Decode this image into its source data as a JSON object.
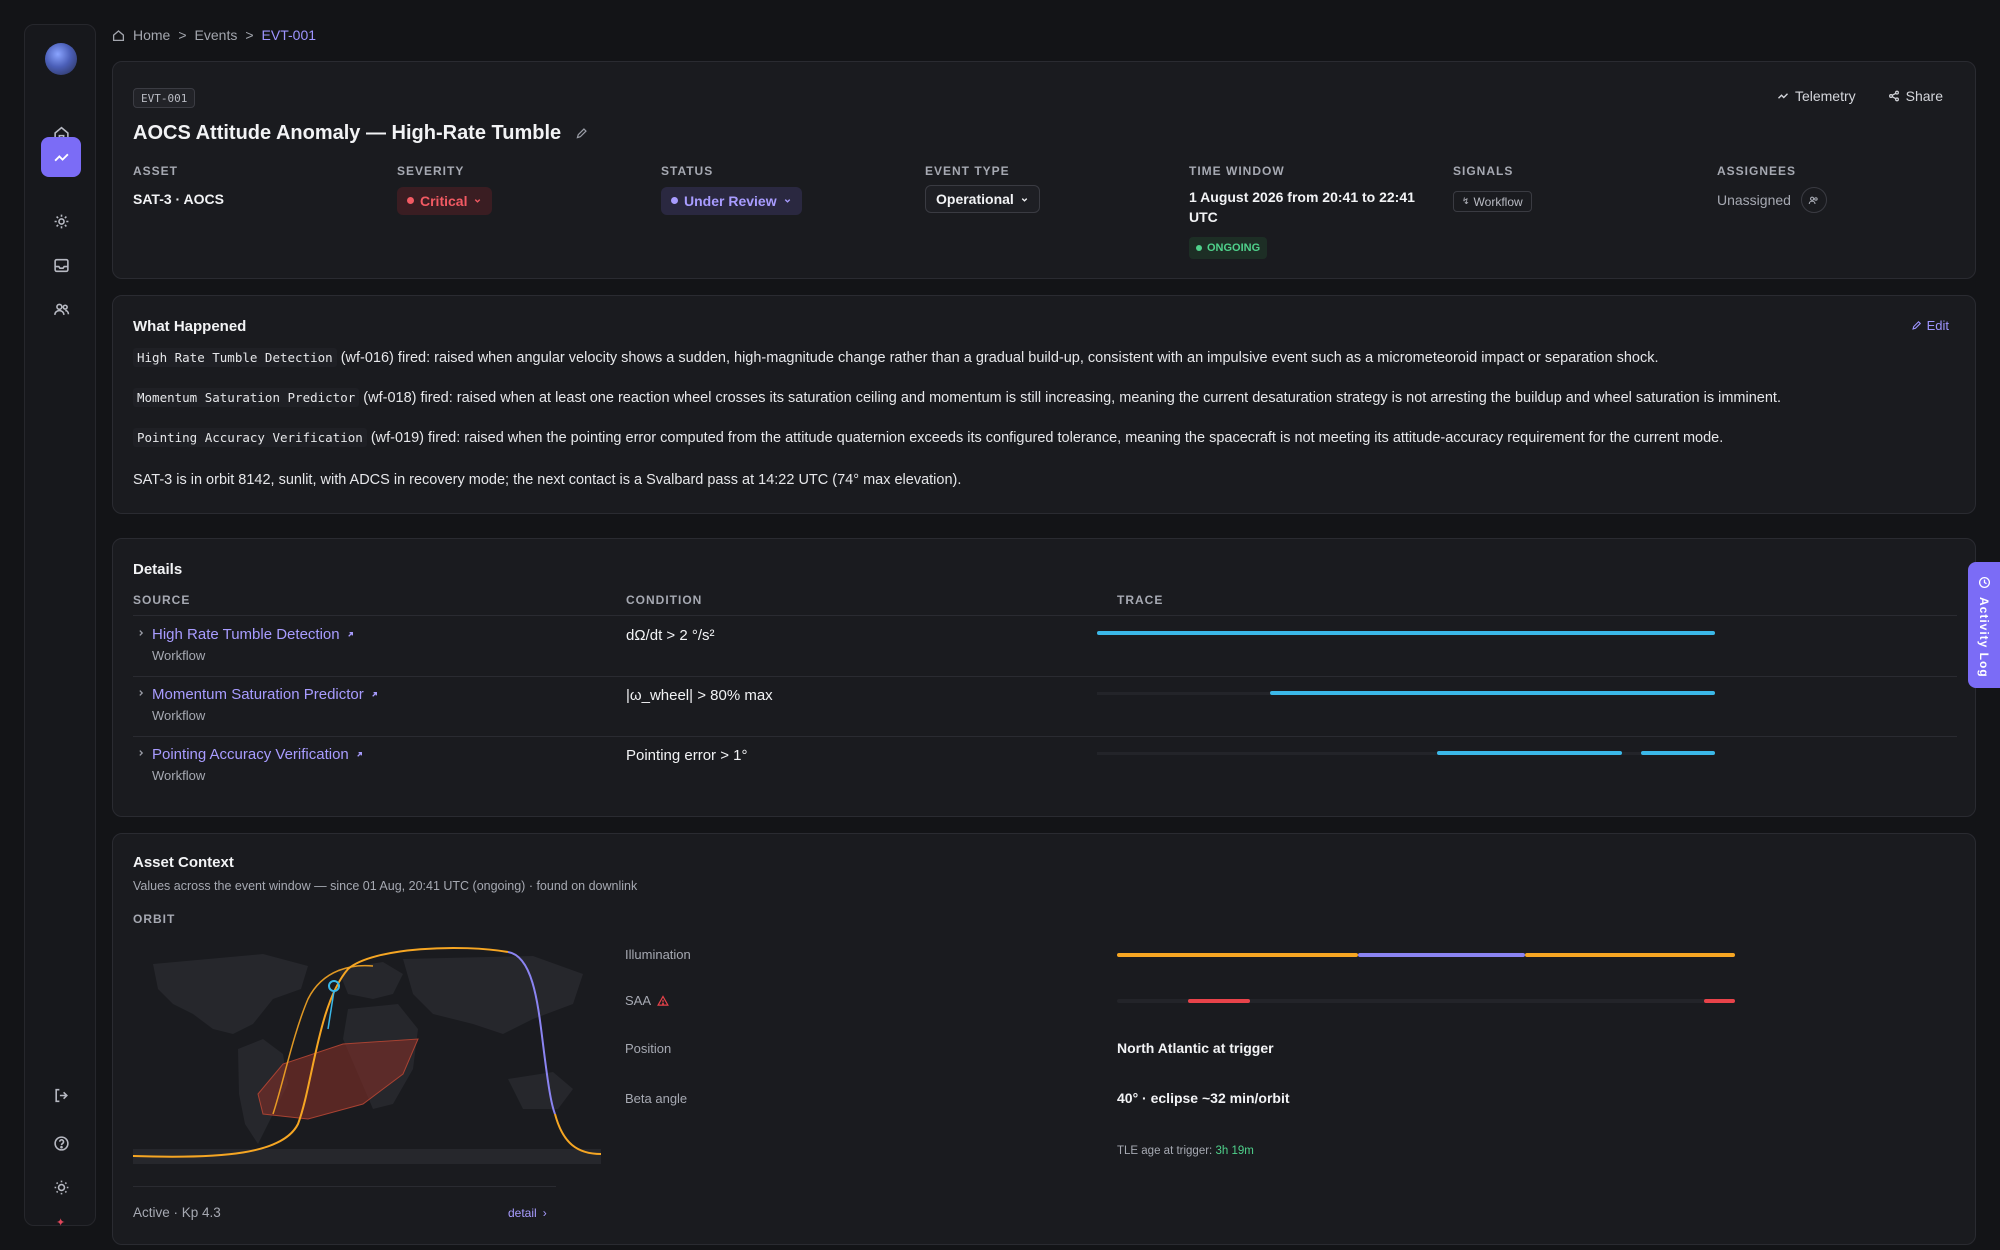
{
  "breadcrumb": {
    "home": "Home",
    "sep1": ">",
    "events": "Events",
    "sep2": ">",
    "current": "EVT-001"
  },
  "event": {
    "id": "EVT-001",
    "title": "AOCS Attitude Anomaly — High-Rate Tumble",
    "actions": {
      "telemetry": "Telemetry",
      "share": "Share"
    },
    "meta": {
      "asset": {
        "label": "ASSET",
        "value": "SAT-3 · AOCS"
      },
      "severity": {
        "label": "SEVERITY",
        "value": "Critical",
        "color": "#f25a63"
      },
      "status": {
        "label": "STATUS",
        "value": "Under Review",
        "color": "#a89cff"
      },
      "event_type": {
        "label": "EVENT TYPE",
        "value": "Operational"
      },
      "time_window": {
        "label": "TIME WINDOW",
        "value": "1 August 2026 from 20:41 to 22:41 UTC",
        "badge": "ONGOING"
      },
      "signals": {
        "label": "SIGNALS",
        "value": "Workflow"
      },
      "assignees": {
        "label": "ASSIGNEES",
        "value": "Unassigned"
      }
    }
  },
  "what_happened": {
    "title": "What Happened",
    "edit": "Edit",
    "items": [
      {
        "code": "High Rate Tumble Detection",
        "text": "(wf-016) fired: raised when angular velocity shows a sudden, high-magnitude change rather than a gradual build-up, consistent with an impulsive event such as a micrometeoroid impact or separation shock."
      },
      {
        "code": "Momentum Saturation Predictor",
        "text": "(wf-018) fired: raised when at least one reaction wheel crosses its saturation ceiling and momentum is still increasing, meaning the current desaturation strategy is not arresting the buildup and wheel saturation is imminent."
      },
      {
        "code": "Pointing Accuracy Verification",
        "text": "(wf-019) fired: raised when the pointing error computed from the attitude quaternion exceeds its configured tolerance, meaning the spacecraft is not meeting its attitude-accuracy requirement for the current mode."
      }
    ],
    "summary": "SAT-3 is in orbit 8142, sunlit, with ADCS in recovery mode; the next contact is a Svalbard pass at 14:22 UTC (74° max elevation)."
  },
  "details": {
    "title": "Details",
    "columns": {
      "source": "SOURCE",
      "condition": "CONDITION",
      "trace": "TRACE"
    },
    "rows": [
      {
        "source": "High Rate Tumble Detection",
        "type": "Workflow",
        "condition": "dΩ/dt > 2 °/s²",
        "trace_active": [
          [
            0.0,
            1.0
          ]
        ]
      },
      {
        "source": "Momentum Saturation Predictor",
        "type": "Workflow",
        "condition": "|ω_wheel| > 80% max",
        "trace_active": [
          [
            0.28,
            1.0
          ]
        ]
      },
      {
        "source": "Pointing Accuracy Verification",
        "type": "Workflow",
        "condition": "Pointing error > 1°",
        "trace_active": [
          [
            0.55,
            0.85
          ],
          [
            0.88,
            1.0
          ]
        ]
      }
    ],
    "trace_color": "#3bb8e8"
  },
  "asset_context": {
    "title": "Asset Context",
    "subtitle": "Values across the event window — since 01 Aug, 20:41 UTC (ongoing) · found on downlink",
    "orbit_label": "ORBIT",
    "status": "Active · Kp 4.3",
    "detail_link": "detail",
    "illumination": {
      "label": "Illumination",
      "sunlit_color": "#f6a623",
      "eclipse_color": "#8b84f2",
      "eclipse_fraction": [
        0.39,
        0.66
      ]
    },
    "saa": {
      "label": "SAA",
      "color": "#e8434a",
      "passes": [
        [
          0.115,
          0.215
        ],
        [
          0.95,
          1.0
        ]
      ]
    },
    "position": {
      "label": "Position",
      "value": "North Atlantic at trigger"
    },
    "beta_angle": {
      "label": "Beta angle",
      "value": "40° · eclipse ~32 min/orbit"
    },
    "tle": {
      "label": "TLE age at trigger:",
      "value": "3h 19m"
    }
  },
  "activity_log": {
    "label": "Activity Log"
  }
}
